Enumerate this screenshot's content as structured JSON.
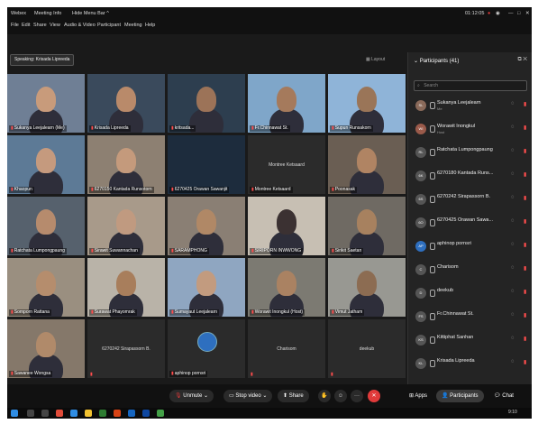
{
  "titlebar": {
    "app_label": "Webex",
    "meeting_info": "Meeting Info",
    "hide_menu": "Hide Menu Bar ^",
    "menus": [
      "File",
      "Edit",
      "Share",
      "View",
      "Audio & Video",
      "Participant",
      "Meeting",
      "Help"
    ],
    "time": "01:12:05",
    "window_controls": [
      "—",
      "□",
      "✕"
    ]
  },
  "speaking_indicator": "Speaking: Krisada Lipreeda",
  "layout_label": "Layout",
  "video_tiles": [
    {
      "label": "Sukanya Leejalearn (Me)",
      "bg": "#6f7f95",
      "face": "#c89b7b"
    },
    {
      "label": "Krisada Lipreeda",
      "bg": "#3a4a5c",
      "face": "#b98a6a"
    },
    {
      "label": "kritsada...",
      "bg": "#2d3e4f",
      "face": "#9c7358"
    },
    {
      "label": "Fr.Chinnawat St.",
      "bg": "#7fa6c9",
      "face": "#a57a5c"
    },
    {
      "label": "Supun Runsakorn",
      "bg": "#8fb4d8",
      "face": "#9a7558"
    },
    {
      "label": "Khaopun",
      "bg": "#5d7a96",
      "face": "#c59a7e"
    },
    {
      "label": "6270150 Kantada Runsotorn",
      "bg": "#8d8072",
      "face": "#c49a7c"
    },
    {
      "label": "6270425 Orawan Sawanjit",
      "bg": "#1d2c3d",
      "face": ""
    },
    {
      "label": "Montree Ketsaard",
      "bg": "#2b2b2b",
      "face": "",
      "center": "Montree Ketsaard"
    },
    {
      "label": "Poonasak",
      "bg": "#6a5e53",
      "face": "#b08463"
    },
    {
      "label": "Ratchata Lumpongpaung",
      "bg": "#56616d",
      "face": "#b68b6d"
    },
    {
      "label": "Sirawit Suwannachan",
      "bg": "#a89a8a",
      "face": "#c09a80"
    },
    {
      "label": "SARAMPHONG",
      "bg": "#8a7f74",
      "face": "#b08866"
    },
    {
      "label": "SIRIPORN INWWONG",
      "bg": "#c7bfb3",
      "face": "#3b3132"
    },
    {
      "label": "Sirikit Saetan",
      "bg": "#6f6a63",
      "face": "#a7815f"
    },
    {
      "label": "Somporn Rattana",
      "bg": "#9a8f80",
      "face": "#b58d6d"
    },
    {
      "label": "Surawat Phayomrak",
      "bg": "#b9b3a8",
      "face": "#a87e5c"
    },
    {
      "label": "Sumayaut Leejalearn",
      "bg": "#8fa6c1",
      "face": "#c29b7f"
    },
    {
      "label": "Worawit Inongkul (Host)",
      "bg": "#7c7a72",
      "face": "#aa8262"
    },
    {
      "label": "Vimut Jatham",
      "bg": "#989892",
      "face": "#8c6c52"
    },
    {
      "label": "Sawanee Wongsa",
      "bg": "#85786a",
      "face": "#b08a6a"
    },
    {
      "label": "",
      "bg": "#2b2b2b",
      "face": "",
      "center": "6270242 Sirapassorn B."
    },
    {
      "label": "aphinop pornsri",
      "bg": "#2b2b2b",
      "face": "",
      "avatar": true
    },
    {
      "label": "",
      "bg": "#2b2b2b",
      "face": "",
      "center": "Charisom"
    },
    {
      "label": "",
      "bg": "#2b2b2b",
      "face": "",
      "center": "deekub"
    }
  ],
  "participants_panel": {
    "title": "Participants (41)",
    "search_placeholder": "Search",
    "participants": [
      {
        "name": "Sukanya Leejalearn",
        "role": "Me",
        "initials": "SL",
        "color": "#8a6a5a"
      },
      {
        "name": "Worawit Inongkul",
        "role": "Host",
        "initials": "WI",
        "color": "#9a5a4a"
      },
      {
        "name": "Ratchata Lumpongpaung",
        "role": "",
        "initials": "RL",
        "color": "#555"
      },
      {
        "name": "6270180 Kantada Runs...",
        "role": "",
        "initials": "6K",
        "color": "#555"
      },
      {
        "name": "6270242 Sirapassorn B.",
        "role": "",
        "initials": "6S",
        "color": "#555"
      },
      {
        "name": "6270425 Orawan Sawa...",
        "role": "",
        "initials": "6O",
        "color": "#555"
      },
      {
        "name": "aphinop pornsri",
        "role": "",
        "initials": "AP",
        "color": "#2e6fbf"
      },
      {
        "name": "Charisom",
        "role": "",
        "initials": "C",
        "color": "#555"
      },
      {
        "name": "deekub",
        "role": "",
        "initials": "D",
        "color": "#555"
      },
      {
        "name": "Fr.Chinnawat St.",
        "role": "",
        "initials": "FS",
        "color": "#555"
      },
      {
        "name": "Kittiphat Sanhan",
        "role": "",
        "initials": "KS",
        "color": "#555"
      },
      {
        "name": "Krisada Lipreeda",
        "role": "",
        "initials": "KL",
        "color": "#555"
      }
    ]
  },
  "toolbar": {
    "unmute": "Unmute",
    "stop_video": "Stop video",
    "share": "Share",
    "apps": "Apps",
    "participants": "Participants",
    "chat": "Chat",
    "end_icon": "✕",
    "more": "···"
  },
  "taskbar": {
    "time": "9:10"
  },
  "colors": {
    "accent_red": "#e03a3a",
    "panel_bg": "#242424",
    "meeting_bg": "#1a1a1a"
  }
}
